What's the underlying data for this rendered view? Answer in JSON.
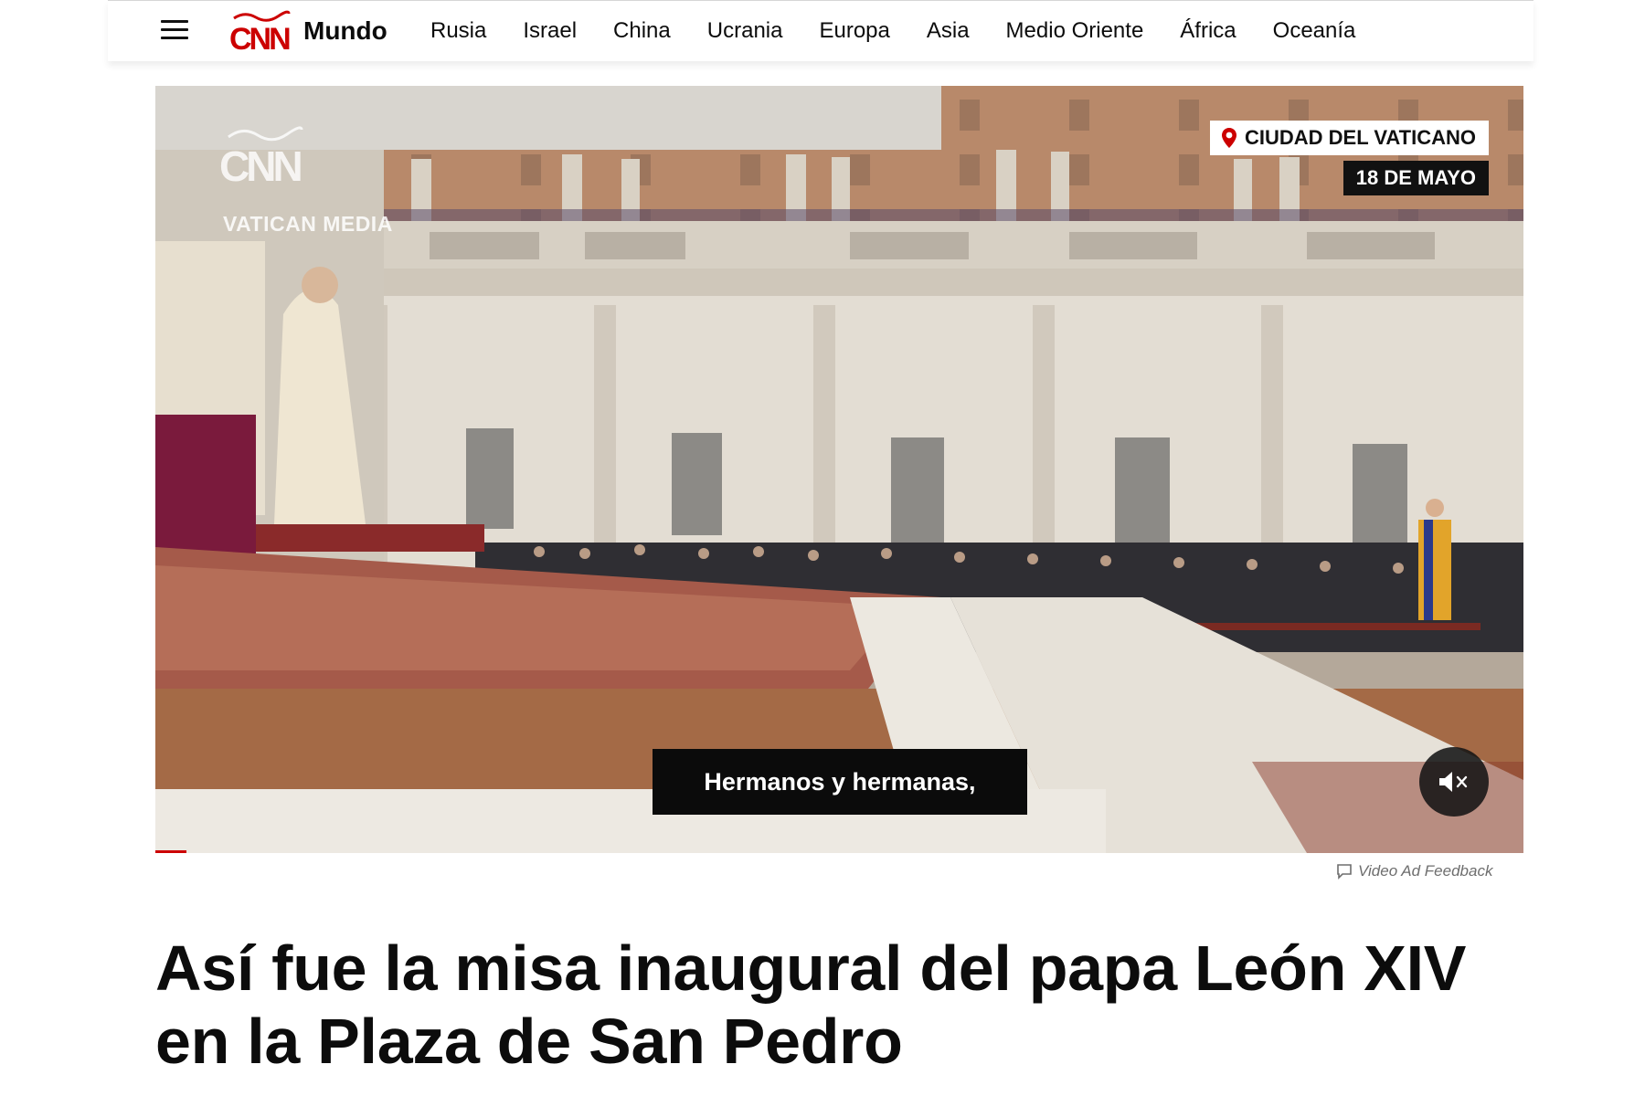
{
  "header": {
    "section_title": "Mundo",
    "logo_text": "CNN",
    "nav": [
      "Rusia",
      "Israel",
      "China",
      "Ucrania",
      "Europa",
      "Asia",
      "Medio Oriente",
      "África",
      "Oceanía"
    ]
  },
  "video": {
    "watermark_logo": "CNN",
    "watermark_source": "VATICAN MEDIA",
    "location": "CIUDAD DEL VATICANO",
    "date": "18 DE MAYO",
    "caption": "Hermanos y hermanas,",
    "muted": true
  },
  "feedback_label": "Video Ad Feedback",
  "headline": "Así fue la misa inaugural del papa León XIV en la Plaza de San Pedro",
  "colors": {
    "brand": "#cc0000",
    "text": "#0c0c0c"
  }
}
